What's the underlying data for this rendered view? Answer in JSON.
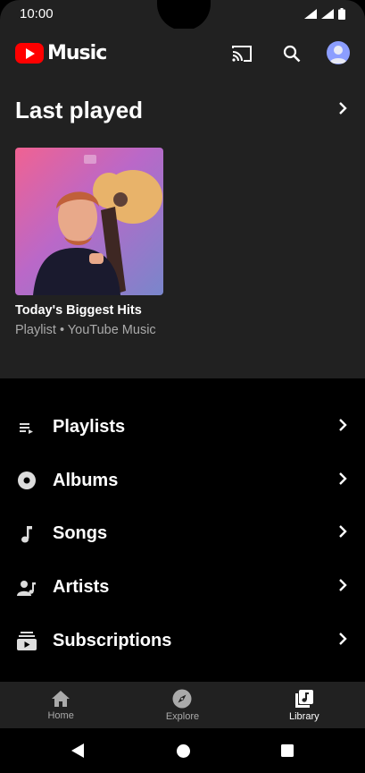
{
  "status_bar": {
    "time": "10:00"
  },
  "app": {
    "logo_text": "Music",
    "brand_color": "#ff0000"
  },
  "last_played": {
    "title": "Last played",
    "items": [
      {
        "title": "Today's Biggest Hits",
        "subtitle": "Playlist • YouTube Music"
      }
    ]
  },
  "library": {
    "items": [
      {
        "label": "Playlists",
        "icon": "playlist-icon"
      },
      {
        "label": "Albums",
        "icon": "album-icon"
      },
      {
        "label": "Songs",
        "icon": "music-note-icon"
      },
      {
        "label": "Artists",
        "icon": "artist-icon"
      },
      {
        "label": "Subscriptions",
        "icon": "subscriptions-icon"
      }
    ]
  },
  "bottom_nav": {
    "items": [
      {
        "label": "Home",
        "icon": "home-icon",
        "active": false
      },
      {
        "label": "Explore",
        "icon": "compass-icon",
        "active": false
      },
      {
        "label": "Library",
        "icon": "library-icon",
        "active": true
      }
    ]
  }
}
